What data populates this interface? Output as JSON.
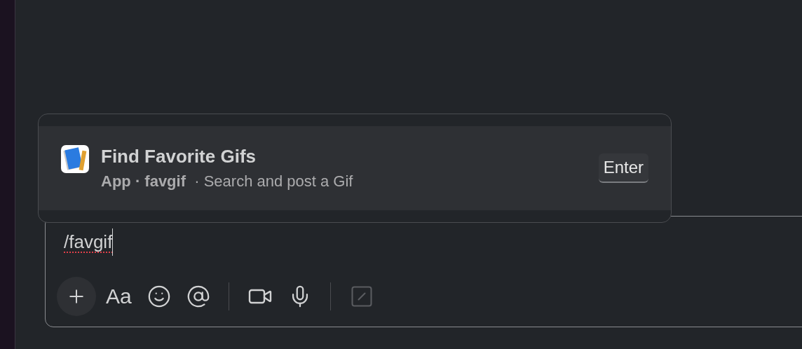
{
  "suggestion": {
    "title": "Find Favorite Gifs",
    "details": "**App · favgif**  · Search and post a Gif",
    "shortcut": "Enter",
    "selected": true
  },
  "composer": {
    "value": "/favgif",
    "misspelled": true
  },
  "toolbar": [
    {
      "kind": "plus",
      "disabled": false
    },
    {
      "kind": "format",
      "label": "Aa",
      "disabled": false
    },
    {
      "kind": "emoji",
      "disabled": false
    },
    {
      "kind": "mention",
      "disabled": false
    },
    {
      "kind": "divider"
    },
    {
      "kind": "video",
      "disabled": false
    },
    {
      "kind": "mic",
      "disabled": false
    },
    {
      "kind": "divider"
    },
    {
      "kind": "shortcuts",
      "disabled": true
    }
  ]
}
